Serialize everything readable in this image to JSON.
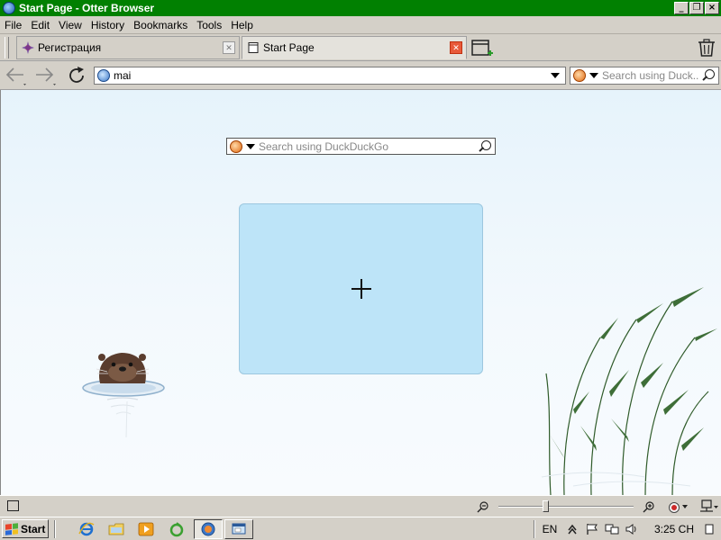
{
  "window": {
    "title": "Start Page - Otter Browser",
    "controls": {
      "minimize": "_",
      "restore": "❐",
      "close": "×"
    }
  },
  "menu": [
    "File",
    "Edit",
    "View",
    "History",
    "Bookmarks",
    "Tools",
    "Help"
  ],
  "tabs": [
    {
      "label": "Регистрация",
      "active": false
    },
    {
      "label": "Start Page",
      "active": true
    }
  ],
  "address_bar": {
    "value": "mai"
  },
  "toolbar_search": {
    "placeholder": "Search using Duck..."
  },
  "start_page": {
    "search_placeholder": "Search using DuckDuckGo",
    "add_tile_symbol": "+"
  },
  "taskbar": {
    "start_label": "Start",
    "language": "EN",
    "clock": "3:25 CH"
  },
  "colors": {
    "titlebar": "#018001",
    "speed_dial_tile": "#bde4f8",
    "content_background": "#e6f3fb",
    "active_tab_close": "#e85a3a"
  },
  "icons": {
    "back": "arrow-left-icon",
    "forward": "arrow-right-icon",
    "reload": "reload-icon",
    "new_tab": "new-tab-icon",
    "trash": "trash-icon",
    "search_engine": "duckduckgo-icon"
  }
}
